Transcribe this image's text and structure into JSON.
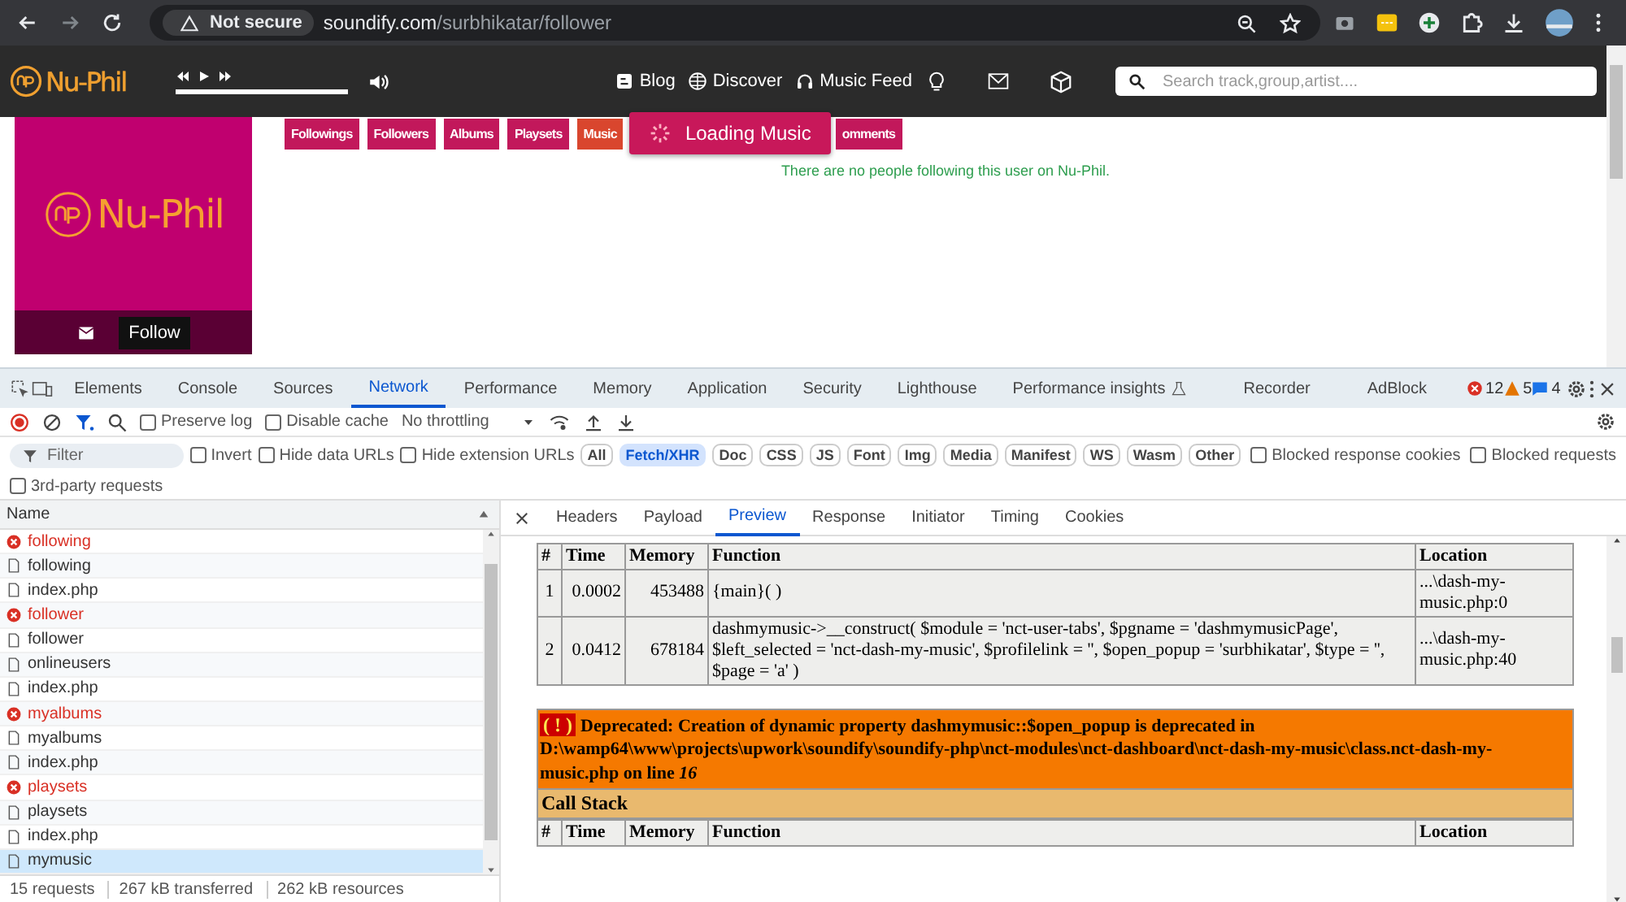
{
  "browser": {
    "security": "Not secure",
    "url_host": "soundify.com",
    "url_path": "/surbhikatar/follower"
  },
  "site": {
    "logo": "Nu-Phil",
    "progress": {
      "level": 1
    },
    "nav": [
      {
        "label": "Blog"
      },
      {
        "label": "Discover"
      },
      {
        "label": "Music Feed"
      }
    ],
    "search": {
      "placeholder": "Search track,group,artist...."
    },
    "tabs": [
      {
        "label": "Followings",
        "color": "#c2185b"
      },
      {
        "label": "Followers",
        "color": "#c2185b"
      },
      {
        "label": "Albums",
        "color": "#c2185b"
      },
      {
        "label": "Playsets",
        "color": "#c2185b"
      },
      {
        "label": "Music",
        "color": "#d9462e"
      },
      {
        "label": "omments",
        "color": "#c2185b"
      }
    ],
    "toast": "Loading Music",
    "message": "There are no people following this user on Nu-Phil.",
    "profile": {
      "logo": "Nu-Phil",
      "follow": "Follow"
    }
  },
  "devtools": {
    "tabs": [
      {
        "label": "Elements",
        "selected": false
      },
      {
        "label": "Console",
        "selected": false
      },
      {
        "label": "Sources",
        "selected": false
      },
      {
        "label": "Network",
        "selected": true
      },
      {
        "label": "Performance",
        "selected": false
      },
      {
        "label": "Memory",
        "selected": false
      },
      {
        "label": "Application",
        "selected": false
      },
      {
        "label": "Security",
        "selected": false
      },
      {
        "label": "Lighthouse",
        "selected": false
      },
      {
        "label": "Performance insights",
        "selected": false
      },
      {
        "label": "Recorder",
        "selected": false
      },
      {
        "label": "AdBlock",
        "selected": false
      }
    ],
    "counts": {
      "errors": "12",
      "warnings": "5",
      "messages": "4"
    },
    "toolbar": {
      "preserve_log": {
        "label": "Preserve log",
        "checked": false
      },
      "disable_cache": {
        "label": "Disable cache",
        "checked": false
      },
      "throttling": "No throttling"
    },
    "filter": {
      "placeholder": "Filter",
      "options": [
        {
          "label": "Invert",
          "checked": false
        },
        {
          "label": "Hide data URLs",
          "checked": false
        },
        {
          "label": "Hide extension URLs",
          "checked": false
        }
      ],
      "types": [
        {
          "label": "All",
          "selected": false
        },
        {
          "label": "Fetch/XHR",
          "selected": true
        },
        {
          "label": "Doc",
          "selected": false
        },
        {
          "label": "CSS",
          "selected": false
        },
        {
          "label": "JS",
          "selected": false
        },
        {
          "label": "Font",
          "selected": false
        },
        {
          "label": "Img",
          "selected": false
        },
        {
          "label": "Media",
          "selected": false
        },
        {
          "label": "Manifest",
          "selected": false
        },
        {
          "label": "WS",
          "selected": false
        },
        {
          "label": "Wasm",
          "selected": false
        },
        {
          "label": "Other",
          "selected": false
        }
      ],
      "blocked": [
        {
          "label": "Blocked response cookies",
          "checked": false
        },
        {
          "label": "Blocked requests",
          "checked": false
        }
      ],
      "third_party": {
        "label": "3rd-party requests",
        "checked": false
      }
    },
    "requests": {
      "column": "Name",
      "rows": [
        {
          "name": "following",
          "failed": true,
          "selected": false
        },
        {
          "name": "following",
          "failed": false,
          "selected": false
        },
        {
          "name": "index.php",
          "failed": false,
          "selected": false
        },
        {
          "name": "follower",
          "failed": true,
          "selected": false
        },
        {
          "name": "follower",
          "failed": false,
          "selected": false
        },
        {
          "name": "onlineusers",
          "failed": false,
          "selected": false
        },
        {
          "name": "index.php",
          "failed": false,
          "selected": false
        },
        {
          "name": "myalbums",
          "failed": true,
          "selected": false
        },
        {
          "name": "myalbums",
          "failed": false,
          "selected": false
        },
        {
          "name": "index.php",
          "failed": false,
          "selected": false
        },
        {
          "name": "playsets",
          "failed": true,
          "selected": false
        },
        {
          "name": "playsets",
          "failed": false,
          "selected": false
        },
        {
          "name": "index.php",
          "failed": false,
          "selected": false
        },
        {
          "name": "mymusic",
          "failed": false,
          "selected": true
        }
      ]
    },
    "status": [
      "15 requests",
      "267 kB transferred",
      "262 kB resources"
    ],
    "detail_tabs": [
      {
        "label": "Headers",
        "selected": false
      },
      {
        "label": "Payload",
        "selected": false
      },
      {
        "label": "Preview",
        "selected": true
      },
      {
        "label": "Response",
        "selected": false
      },
      {
        "label": "Initiator",
        "selected": false
      },
      {
        "label": "Timing",
        "selected": false
      },
      {
        "label": "Cookies",
        "selected": false
      }
    ],
    "preview": {
      "columns": [
        "#",
        "Time",
        "Memory",
        "Function",
        "Location"
      ],
      "rows": [
        [
          "1",
          "0.0002",
          "453488",
          "{main}( )",
          "...\\dash-my-music.php:0"
        ],
        [
          "2",
          "0.0412",
          "678184",
          "dashmymusic->__construct( $module = 'nct-user-tabs', $pgname = 'dashmymusicPage', $left_selected = 'nct-dash-my-music', $profilelink = '', $open_popup = 'surbhikatar', $type = '', $page = 'a' )",
          "...\\dash-my-music.php:40"
        ]
      ],
      "error": {
        "icon": "( ! )",
        "message": "Deprecated: Creation of dynamic property dashmymusic::$open_popup is deprecated in D:\\wamp64\\www\\projects\\upwork\\soundify\\soundify-php\\nct-modules\\nct-dashboard\\nct-dash-my-music\\class.nct-dash-my-music.php on line *16*"
      },
      "call_stack": "Call Stack",
      "columns2": [
        "#",
        "Time",
        "Memory",
        "Function",
        "Location"
      ]
    }
  }
}
